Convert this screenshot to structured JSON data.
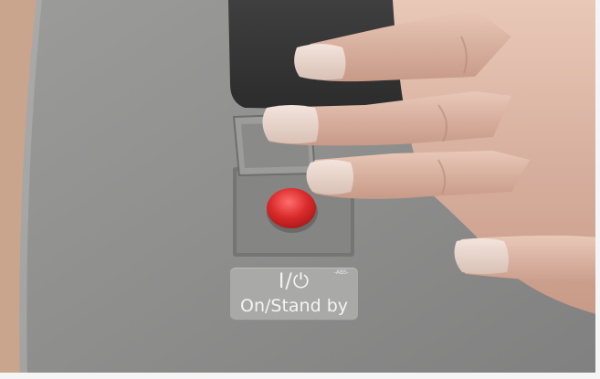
{
  "scene": {
    "button_label": "On/Stand by",
    "symbol_text": "I/⏻",
    "small_mark": "-ABS-"
  },
  "colors": {
    "panel": "#8f8f8e",
    "recess": "#7f7f7e",
    "button": "#d52a2a",
    "skin": "#d8b5a4"
  }
}
